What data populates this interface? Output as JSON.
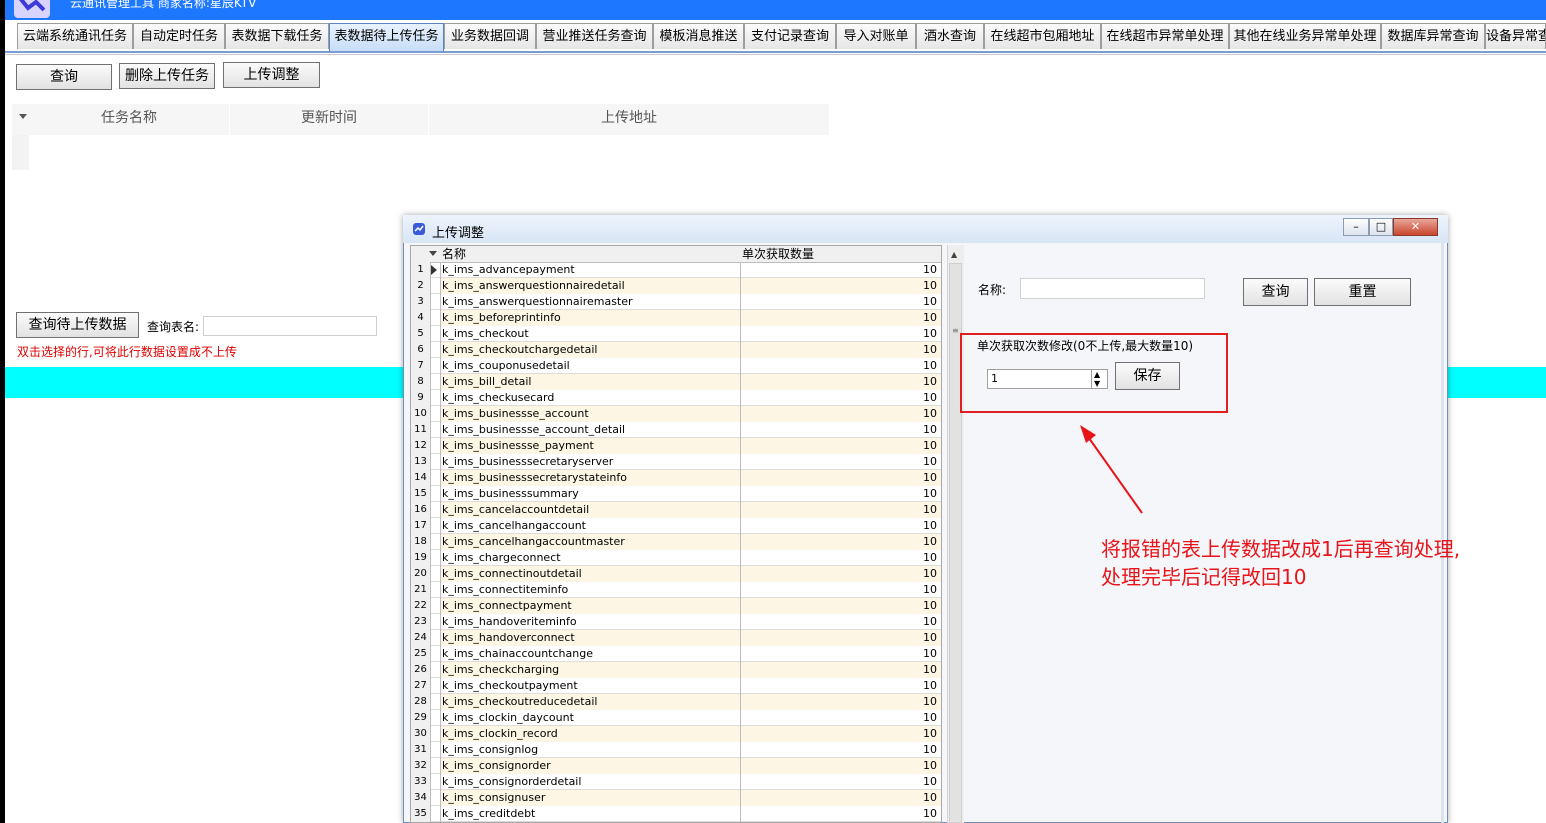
{
  "window": {
    "title": "云通讯管理工具 商家名称:星辰KTV"
  },
  "tabs": [
    {
      "label": "云端系统通讯任务"
    },
    {
      "label": "自动定时任务"
    },
    {
      "label": "表数据下载任务"
    },
    {
      "label": "表数据待上传任务"
    },
    {
      "label": "业务数据回调"
    },
    {
      "label": "营业推送任务查询"
    },
    {
      "label": "模板消息推送"
    },
    {
      "label": "支付记录查询"
    },
    {
      "label": "导入对账单"
    },
    {
      "label": "酒水查询"
    },
    {
      "label": "在线超市包厢地址"
    },
    {
      "label": "在线超市异常单处理"
    },
    {
      "label": "其他在线业务异常单处理"
    },
    {
      "label": "数据库异常查询"
    },
    {
      "label": "设备异常查"
    }
  ],
  "toolbar": {
    "query_label": "查询",
    "delete_label": "删除上传任务",
    "adjust_label": "上传调整"
  },
  "upload_grid": {
    "columns": [
      "任务名称",
      "更新时间",
      "上传地址"
    ]
  },
  "query_area": {
    "button_label": "查询待上传数据",
    "table_name_label": "查询表名:",
    "table_name_value": "",
    "hint": "双击选择的行,可将此行数据设置成不上传"
  },
  "dialog": {
    "title": "上传调整",
    "columns": [
      "名称",
      "单次获取数量"
    ],
    "rows": [
      {
        "no": "1",
        "name": "k_ims_advancepayment",
        "qty": "10"
      },
      {
        "no": "2",
        "name": "k_ims_answerquestionnairedetail",
        "qty": "10"
      },
      {
        "no": "3",
        "name": "k_ims_answerquestionnairemaster",
        "qty": "10"
      },
      {
        "no": "4",
        "name": "k_ims_beforeprintinfo",
        "qty": "10"
      },
      {
        "no": "5",
        "name": "k_ims_checkout",
        "qty": "10"
      },
      {
        "no": "6",
        "name": "k_ims_checkoutchargedetail",
        "qty": "10"
      },
      {
        "no": "7",
        "name": "k_ims_couponusedetail",
        "qty": "10"
      },
      {
        "no": "8",
        "name": "k_ims_bill_detail",
        "qty": "10"
      },
      {
        "no": "9",
        "name": "k_ims_checkusecard",
        "qty": "10"
      },
      {
        "no": "10",
        "name": "k_ims_businessse_account",
        "qty": "10"
      },
      {
        "no": "11",
        "name": "k_ims_businessse_account_detail",
        "qty": "10"
      },
      {
        "no": "12",
        "name": "k_ims_businessse_payment",
        "qty": "10"
      },
      {
        "no": "13",
        "name": "k_ims_businesssecretaryserver",
        "qty": "10"
      },
      {
        "no": "14",
        "name": "k_ims_businesssecretarystateinfo",
        "qty": "10"
      },
      {
        "no": "15",
        "name": "k_ims_businesssummary",
        "qty": "10"
      },
      {
        "no": "16",
        "name": "k_ims_cancelaccountdetail",
        "qty": "10"
      },
      {
        "no": "17",
        "name": "k_ims_cancelhangaccount",
        "qty": "10"
      },
      {
        "no": "18",
        "name": "k_ims_cancelhangaccountmaster",
        "qty": "10"
      },
      {
        "no": "19",
        "name": "k_ims_chargeconnect",
        "qty": "10"
      },
      {
        "no": "20",
        "name": "k_ims_connectinoutdetail",
        "qty": "10"
      },
      {
        "no": "21",
        "name": "k_ims_connectiteminfo",
        "qty": "10"
      },
      {
        "no": "22",
        "name": "k_ims_connectpayment",
        "qty": "10"
      },
      {
        "no": "23",
        "name": "k_ims_handoveriteminfo",
        "qty": "10"
      },
      {
        "no": "24",
        "name": "k_ims_handoverconnect",
        "qty": "10"
      },
      {
        "no": "25",
        "name": "k_ims_chainaccountchange",
        "qty": "10"
      },
      {
        "no": "26",
        "name": "k_ims_checkcharging",
        "qty": "10"
      },
      {
        "no": "27",
        "name": "k_ims_checkoutpayment",
        "qty": "10"
      },
      {
        "no": "28",
        "name": "k_ims_checkoutreducedetail",
        "qty": "10"
      },
      {
        "no": "29",
        "name": "k_ims_clockin_daycount",
        "qty": "10"
      },
      {
        "no": "30",
        "name": "k_ims_clockin_record",
        "qty": "10"
      },
      {
        "no": "31",
        "name": "k_ims_consignlog",
        "qty": "10"
      },
      {
        "no": "32",
        "name": "k_ims_consignorder",
        "qty": "10"
      },
      {
        "no": "33",
        "name": "k_ims_consignorderdetail",
        "qty": "10"
      },
      {
        "no": "34",
        "name": "k_ims_consignuser",
        "qty": "10"
      },
      {
        "no": "35",
        "name": "k_ims_creditdebt",
        "qty": "10"
      }
    ],
    "name_label": "名称:",
    "name_value": "",
    "query_label": "查询",
    "reset_label": "重置",
    "group_title": "单次获取次数修改(0不上传,最大数量10)",
    "qty_value": "1",
    "save_label": "保存"
  },
  "annotation": {
    "line1": "将报错的表上传数据改成1后再查询处理,",
    "line2": "处理完毕后记得改回10",
    "color": "#e8141a"
  },
  "colors": {
    "titlebar": "#1e78ff",
    "band": "#00ffff",
    "hint": "#e00000",
    "row_alt": "#fdf6e4"
  }
}
